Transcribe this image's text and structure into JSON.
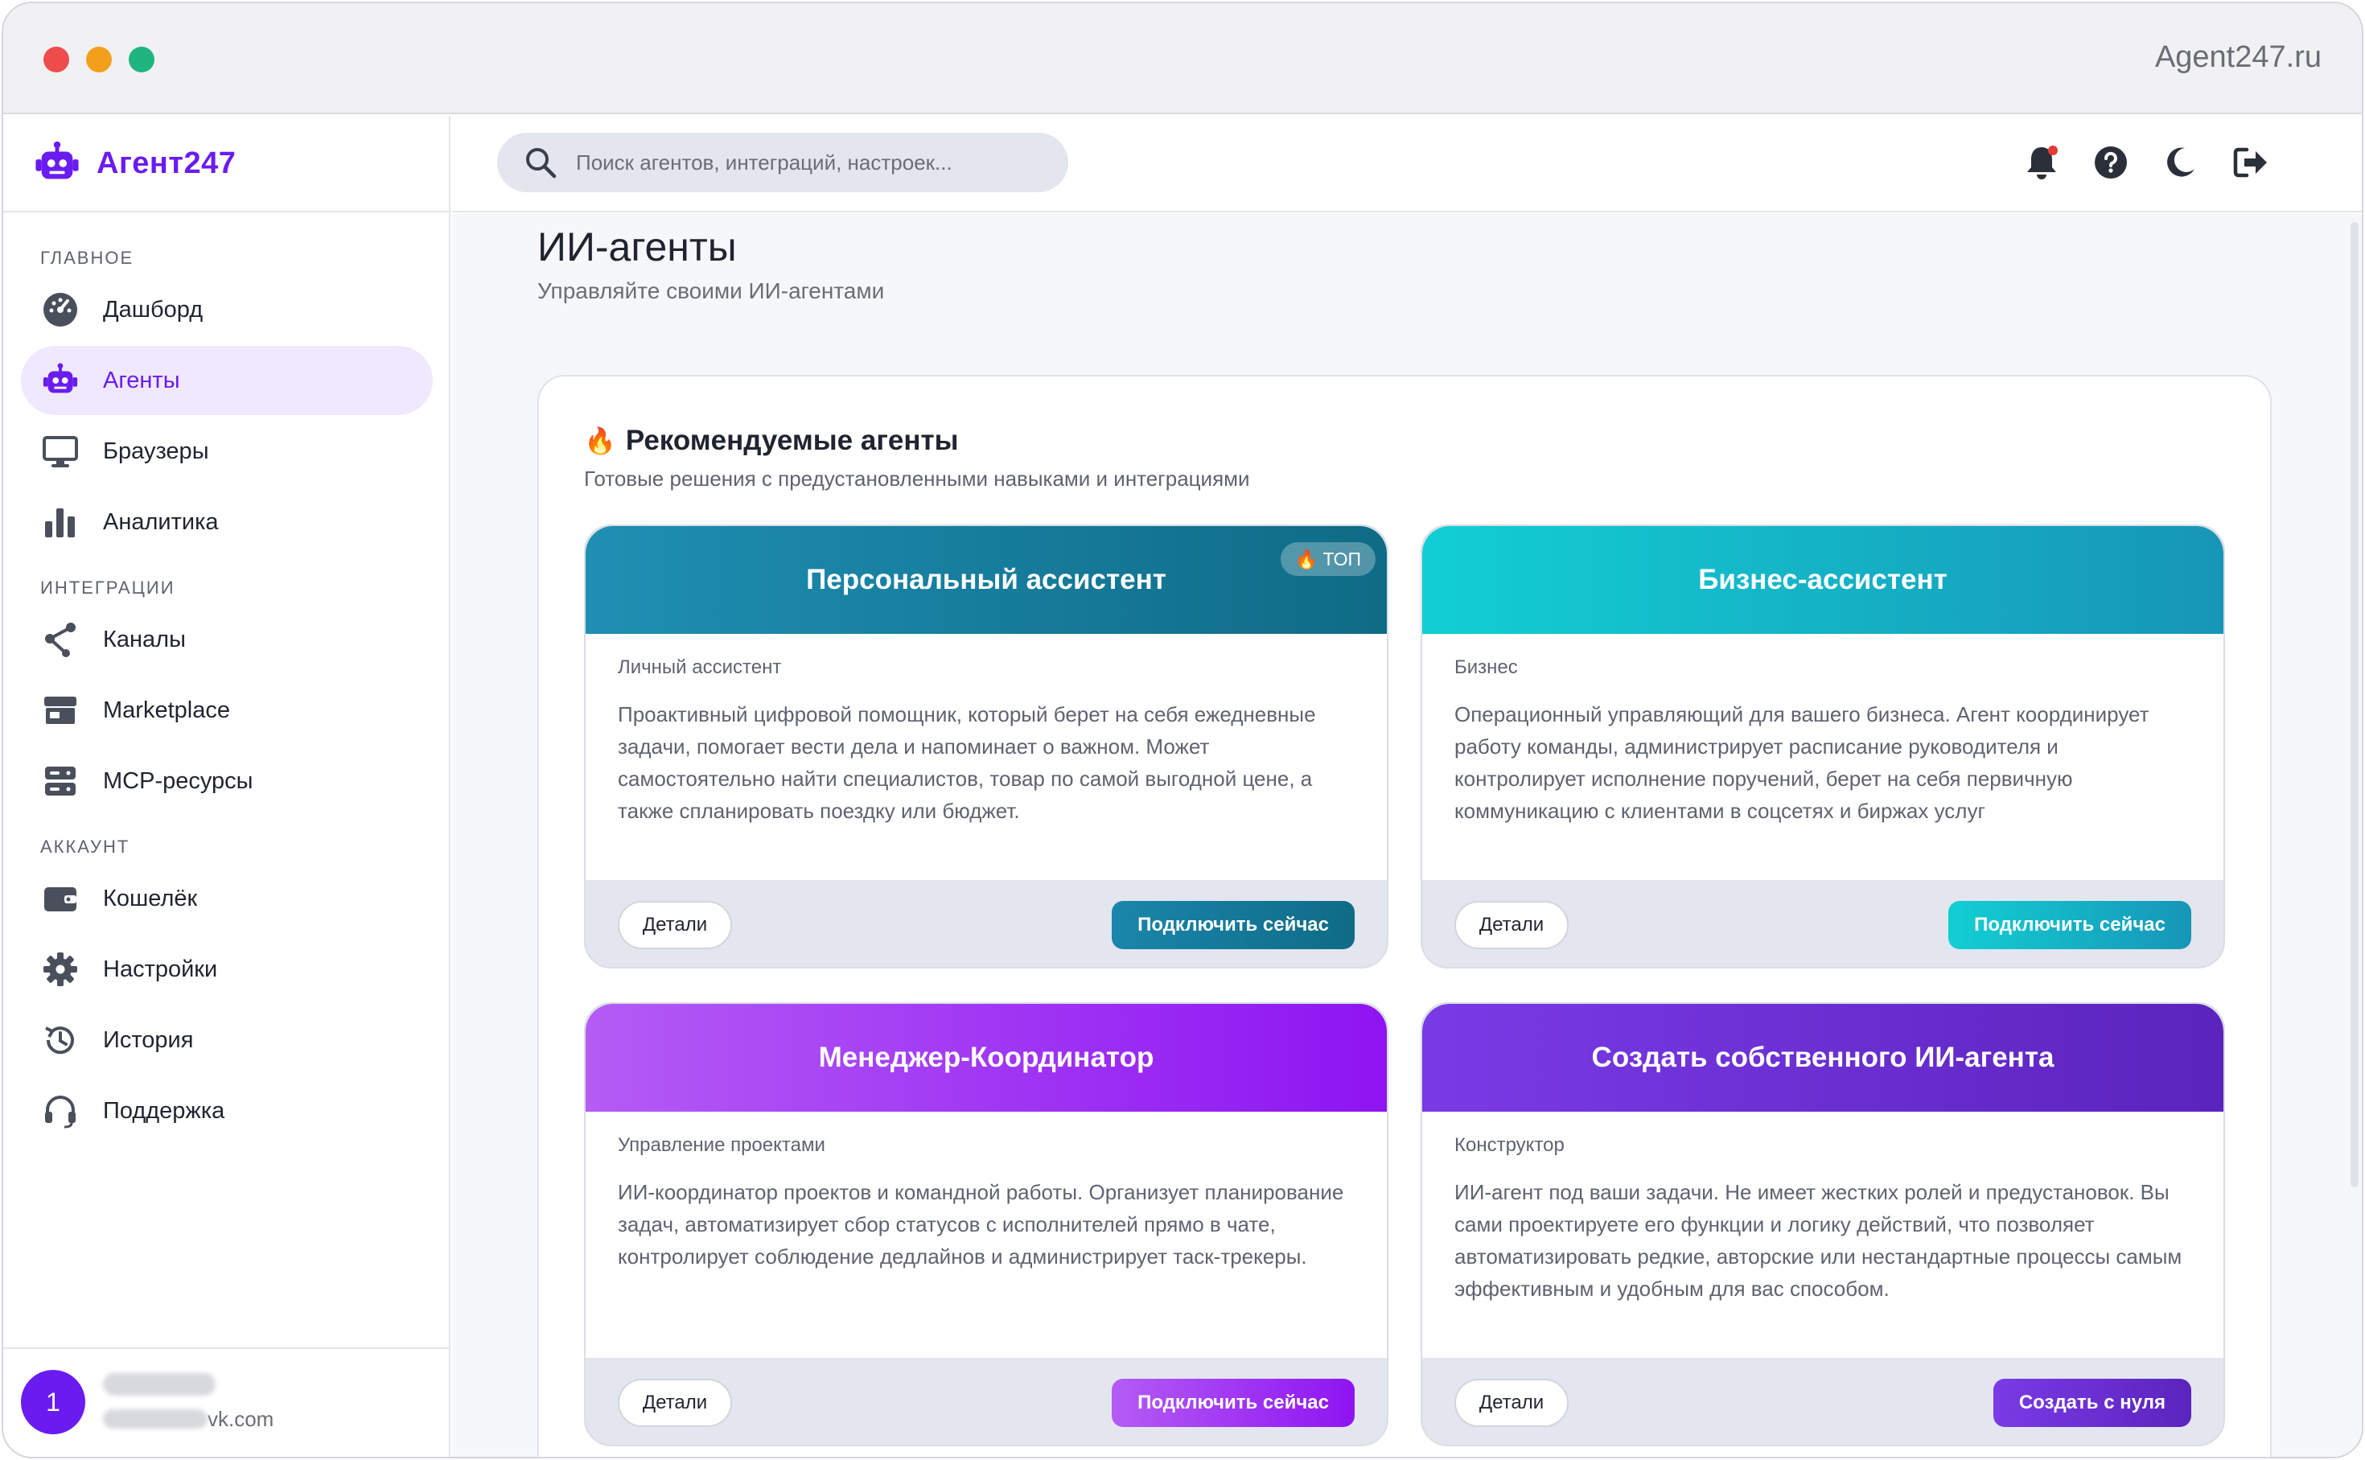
{
  "window": {
    "site_title": "Agent247.ru"
  },
  "app": {
    "name": "Агент247"
  },
  "sidebar": {
    "sections": [
      {
        "label": "ГЛАВНОЕ"
      },
      {
        "label": "ИНТЕГРАЦИИ"
      },
      {
        "label": "АККАУНТ"
      }
    ],
    "items": [
      {
        "label": "Дашборд",
        "icon": "dashboard-gauge-icon",
        "active": false
      },
      {
        "label": "Агенты",
        "icon": "robot-icon",
        "active": true
      },
      {
        "label": "Браузеры",
        "icon": "monitor-icon",
        "active": false
      },
      {
        "label": "Аналитика",
        "icon": "bar-chart-icon",
        "active": false
      },
      {
        "label": "Каналы",
        "icon": "share-nodes-icon",
        "active": false
      },
      {
        "label": "Marketplace",
        "icon": "store-icon",
        "active": false
      },
      {
        "label": "MCP-ресурсы",
        "icon": "server-icon",
        "active": false
      },
      {
        "label": "Кошелёк",
        "icon": "wallet-icon",
        "active": false
      },
      {
        "label": "Настройки",
        "icon": "gear-icon",
        "active": false
      },
      {
        "label": "История",
        "icon": "history-icon",
        "active": false
      },
      {
        "label": "Поддержка",
        "icon": "headset-icon",
        "active": false
      }
    ],
    "user": {
      "initial": "1",
      "email_suffix": "vk.com"
    }
  },
  "header": {
    "search_placeholder": "Поиск агентов, интеграций, настроек...",
    "icons": [
      "bell-icon",
      "help-icon",
      "moon-icon",
      "logout-icon"
    ]
  },
  "page": {
    "title": "ИИ-агенты",
    "subtitle": "Управляйте своими ИИ-агентами"
  },
  "recommended": {
    "emoji": "🔥",
    "title": "Рекомендуемые агенты",
    "subtitle": "Готовые решения с предустановленными навыками и интеграциями",
    "cards": [
      {
        "title": "Персональный ассистент",
        "badge": "🔥 ТОП",
        "category": "Личный ассистент",
        "description": "Проактивный цифровой помощник, который берет на себя ежедневные задачи, помогает вести дела и напоминает о важном. Может самостоятельно найти специалистов, товар по самой выгодной цене, а также спланировать поездку или бюджет.",
        "details_label": "Детали",
        "action_label": "Подключить сейчас",
        "colors": {
          "from": "#1f8fb3",
          "to": "#0f6b86"
        }
      },
      {
        "title": "Бизнес-ассистент",
        "category": "Бизнес",
        "description": "Операционный управляющий для вашего бизнеса. Агент координирует работу команды, администрирует расписание руководителя и контролирует исполнение поручений, берет на себя первичную коммуникацию с клиентами в соцсетях и биржах услуг",
        "details_label": "Детали",
        "action_label": "Подключить сейчас",
        "colors": {
          "from": "#12cfd3",
          "to": "#1796b8"
        }
      },
      {
        "title": "Менеджер-Координатор",
        "category": "Управление проектами",
        "description": "ИИ-координатор проектов и командной работы. Организует планирование задач, автоматизирует сбор статусов с исполнителей прямо в чате, контролирует соблюдение дедлайнов и администрирует таск-трекеры.",
        "details_label": "Детали",
        "action_label": "Подключить сейчас",
        "colors": {
          "from": "#b45cf5",
          "to": "#8e14f2"
        }
      },
      {
        "title": "Создать собственного ИИ-агента",
        "category": "Конструктор",
        "description": "ИИ-агент под ваши задачи. Не имеет жестких ролей и предустановок. Вы сами проектируете его функции и логику действий, что позволяет автоматизировать редкие, авторские или нестандартные процессы самым эффективным и удобным для вас способом.",
        "details_label": "Детали",
        "action_label": "Создать с нуля",
        "colors": {
          "from": "#7a3ae6",
          "to": "#5b24bd"
        }
      }
    ]
  },
  "colors": {
    "brand": "#6a1cf0",
    "active_bg": "#efe8ff",
    "notification_dot": "#e53935"
  }
}
